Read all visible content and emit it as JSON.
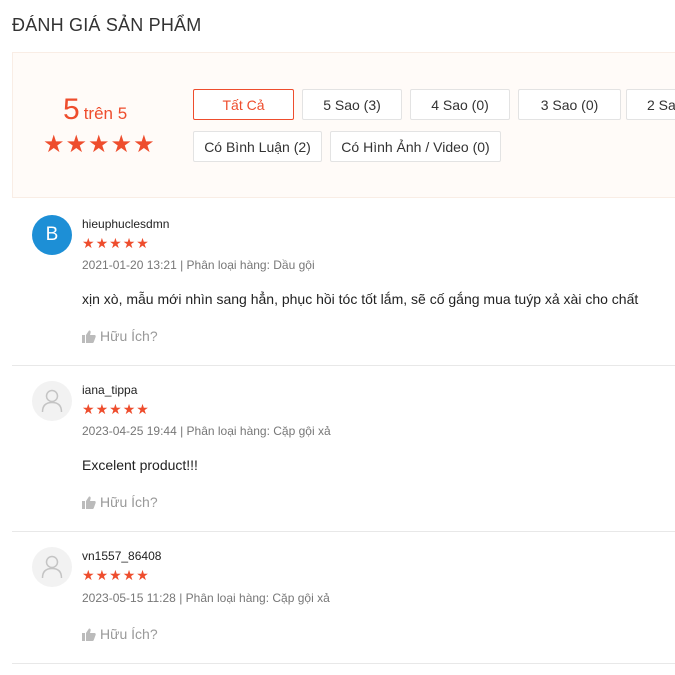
{
  "section_title": "ĐÁNH GIÁ SẢN PHẨM",
  "rating": {
    "score": "5",
    "out_of": "trên 5",
    "stars": 5
  },
  "filters": [
    {
      "label": "Tất Cả",
      "active": true
    },
    {
      "label": "5 Sao (3)"
    },
    {
      "label": "4 Sao (0)"
    },
    {
      "label": "3 Sao (0)"
    },
    {
      "label": "2 Sa"
    },
    {
      "label": "Có Bình Luận (2)"
    },
    {
      "label": "Có Hình Ảnh / Video (0)"
    }
  ],
  "reviews": [
    {
      "avatar_letter": "B",
      "username": "hieuphuclesdmn",
      "stars": 5,
      "meta": "2021-01-20 13:21 | Phân loại hàng: Dầu gội",
      "content": "xịn xò, mẫu mới nhìn sang hẳn, phục hồi tóc tốt lắm, sẽ cố gắng mua tuýp xả xài cho chất",
      "helpful": "Hữu Ích?"
    },
    {
      "avatar_letter": "",
      "username": "iana_tippa",
      "stars": 5,
      "meta": "2023-04-25 19:44 | Phân loại hàng: Cặp gội xả",
      "content": "Excelent product!!!",
      "helpful": "Hữu Ích?"
    },
    {
      "avatar_letter": "",
      "username": "vn1557_86408",
      "stars": 5,
      "meta": "2023-05-15 11:28 | Phân loại hàng: Cặp gội xả",
      "content": "",
      "helpful": "Hữu Ích?"
    }
  ],
  "colors": {
    "accent": "#ee4d2d",
    "avatar_blue": "#1d8fd6"
  },
  "icons": {
    "star": "star-icon",
    "thumbs_up": "thumbs-up-icon",
    "user": "user-icon"
  }
}
